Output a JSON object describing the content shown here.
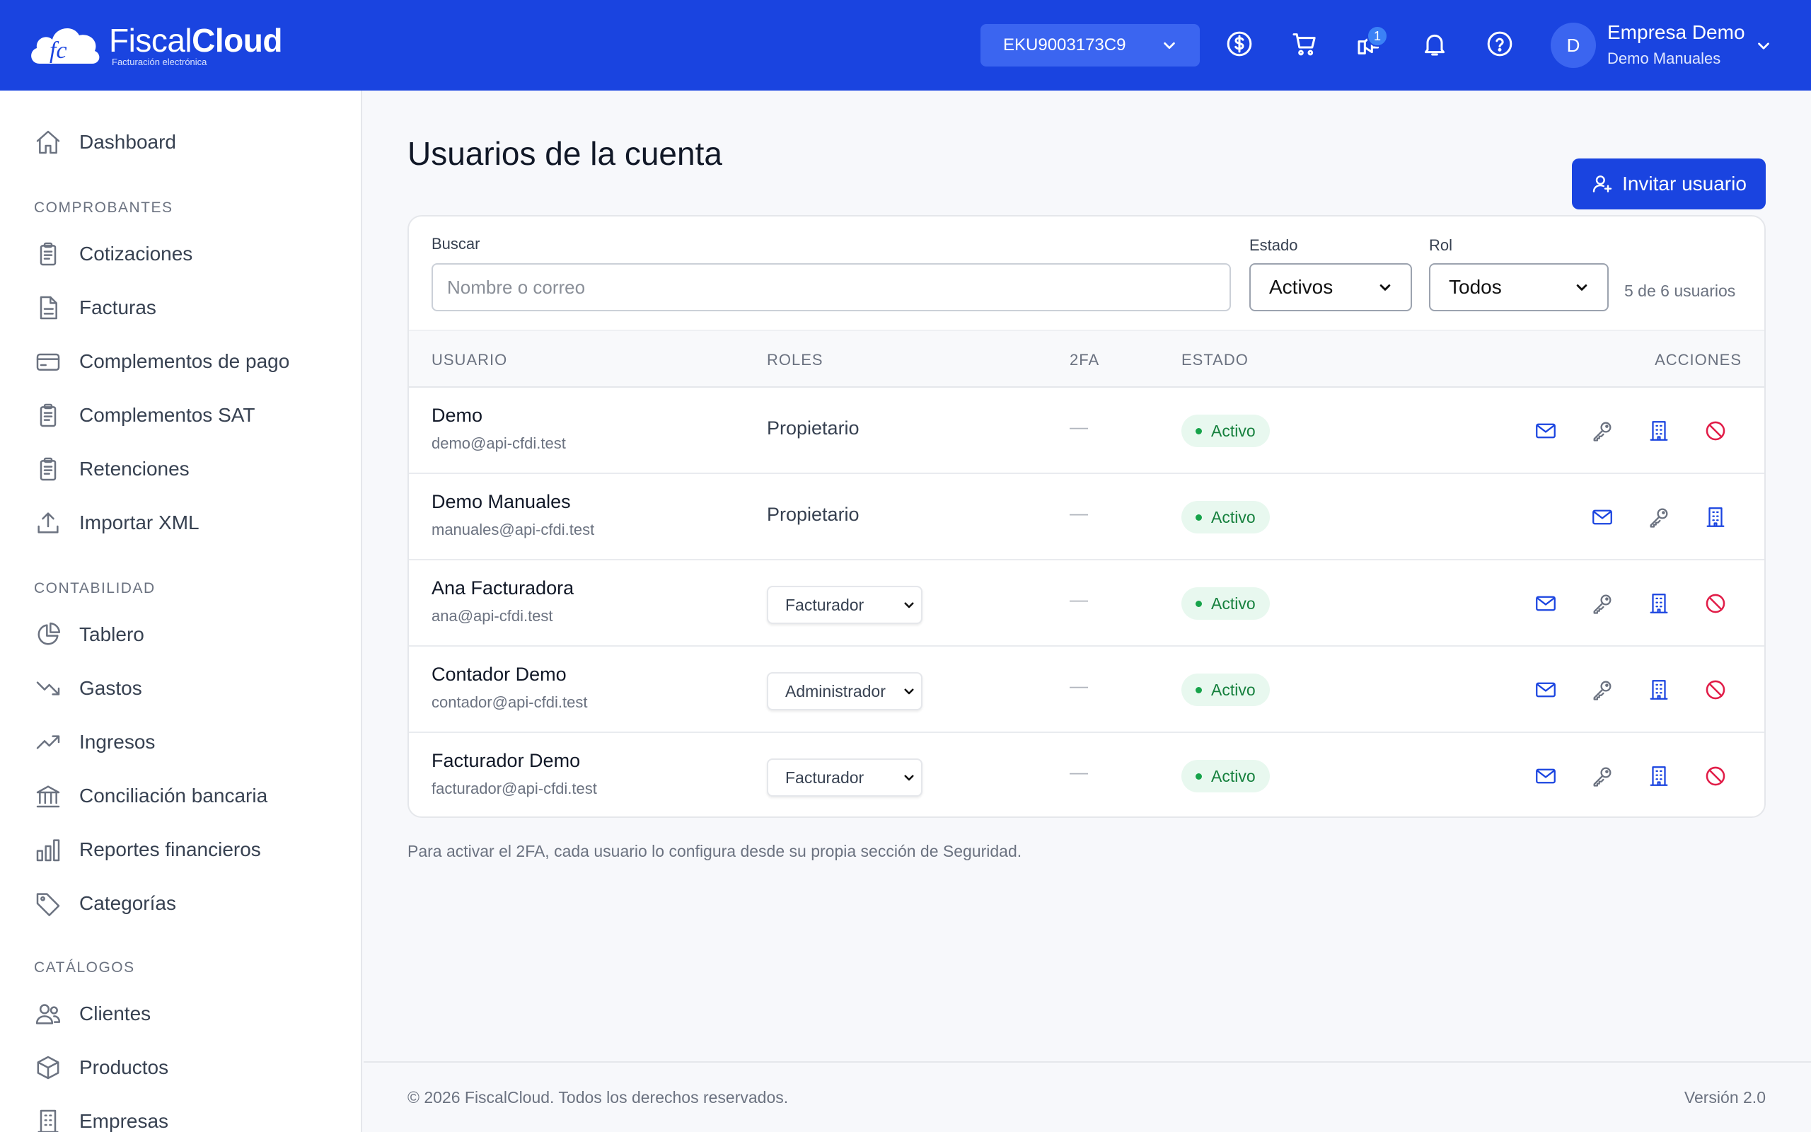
{
  "brand": {
    "name_light": "Fiscal",
    "name_bold": "Cloud",
    "tagline": "Facturación electrónica",
    "logo_mark": "fc"
  },
  "header": {
    "rfc": "EKU9003173C9",
    "notification_count": "1",
    "company": "Empresa Demo",
    "user": "Demo Manuales",
    "avatar_initial": "D"
  },
  "sidebar": {
    "dashboard": "Dashboard",
    "sections": {
      "comprobantes": "COMPROBANTES",
      "contabilidad": "CONTABILIDAD",
      "catalogos": "CATÁLOGOS"
    },
    "items": {
      "cotizaciones": "Cotizaciones",
      "facturas": "Facturas",
      "complementos_pago": "Complementos de pago",
      "complementos_sat": "Complementos SAT",
      "retenciones": "Retenciones",
      "importar_xml": "Importar XML",
      "tablero": "Tablero",
      "gastos": "Gastos",
      "ingresos": "Ingresos",
      "conciliacion": "Conciliación bancaria",
      "reportes": "Reportes financieros",
      "categorias": "Categorías",
      "clientes": "Clientes",
      "productos": "Productos",
      "empresas": "Empresas"
    }
  },
  "main": {
    "title": "Usuarios de la cuenta",
    "invite_button": "Invitar usuario",
    "filters": {
      "search_label": "Buscar",
      "search_placeholder": "Nombre o correo",
      "estado_label": "Estado",
      "estado_value": "Activos",
      "rol_label": "Rol",
      "rol_value": "Todos",
      "count": "5 de 6 usuarios"
    },
    "columns": {
      "usuario": "USUARIO",
      "roles": "ROLES",
      "tfa": "2FA",
      "estado": "ESTADO",
      "acciones": "ACCIONES"
    },
    "rows": [
      {
        "name": "Demo",
        "email": "demo@api-cfdi.test",
        "role": "Propietario",
        "role_editable": false,
        "tfa": "—",
        "status": "Activo",
        "can_disable": true
      },
      {
        "name": "Demo Manuales",
        "email": "manuales@api-cfdi.test",
        "role": "Propietario",
        "role_editable": false,
        "tfa": "—",
        "status": "Activo",
        "can_disable": false
      },
      {
        "name": "Ana Facturadora",
        "email": "ana@api-cfdi.test",
        "role": "Facturador",
        "role_editable": true,
        "tfa": "—",
        "status": "Activo",
        "can_disable": true
      },
      {
        "name": "Contador Demo",
        "email": "contador@api-cfdi.test",
        "role": "Administrador",
        "role_editable": true,
        "tfa": "—",
        "status": "Activo",
        "can_disable": true
      },
      {
        "name": "Facturador Demo",
        "email": "facturador@api-cfdi.test",
        "role": "Facturador",
        "role_editable": true,
        "tfa": "—",
        "status": "Activo",
        "can_disable": true
      }
    ],
    "note": "Para activar el 2FA, cada usuario lo configura desde su propia sección de Seguridad."
  },
  "footer": {
    "copyright": "© 2026 FiscalCloud. Todos los derechos reservados.",
    "version": "Versión 2.0"
  },
  "colors": {
    "primary": "#1a44e0",
    "status_green": "#16a34a",
    "danger": "#e11d48"
  }
}
